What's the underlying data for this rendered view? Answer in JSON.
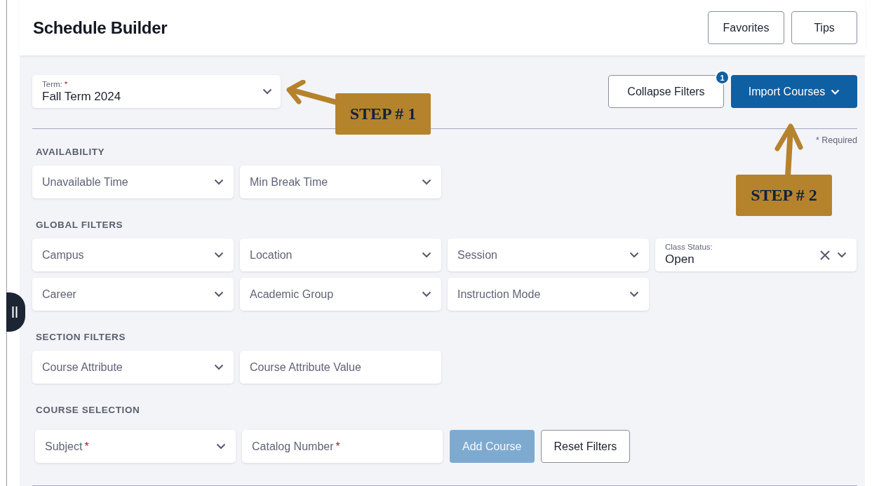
{
  "header": {
    "title": "Schedule Builder",
    "buttons": [
      {
        "label": "Favorites"
      },
      {
        "label": "Tips"
      }
    ]
  },
  "term": {
    "label": "Term:",
    "required_mark": "*",
    "value": "Fall Term 2024"
  },
  "actions": [
    {
      "label": "Collapse Filters",
      "kind": "outline",
      "badge": "1"
    },
    {
      "label": "Import Courses",
      "kind": "primary",
      "caret": true
    }
  ],
  "required_note": "* Required",
  "sections": [
    {
      "title": "AVAILABILITY",
      "rows": [
        [
          {
            "kind": "select",
            "placeholder": "Unavailable Time"
          },
          {
            "kind": "select",
            "placeholder": "Min Break Time"
          }
        ]
      ]
    },
    {
      "title": "GLOBAL FILTERS",
      "rows": [
        [
          {
            "kind": "select",
            "placeholder": "Campus"
          },
          {
            "kind": "select",
            "placeholder": "Location"
          },
          {
            "kind": "select",
            "placeholder": "Session"
          },
          {
            "kind": "select_value",
            "label": "Class Status:",
            "value": "Open",
            "clearable": true
          }
        ],
        [
          {
            "kind": "select",
            "placeholder": "Career"
          },
          {
            "kind": "select",
            "placeholder": "Academic Group"
          },
          {
            "kind": "select",
            "placeholder": "Instruction Mode"
          }
        ]
      ]
    },
    {
      "title": "SECTION FILTERS",
      "rows": [
        [
          {
            "kind": "select",
            "placeholder": "Course Attribute"
          },
          {
            "kind": "input",
            "placeholder": "Course Attribute Value"
          }
        ]
      ]
    },
    {
      "title": "COURSE SELECTION",
      "rows": [
        [
          {
            "kind": "select",
            "placeholder": "Subject",
            "required_mark": "*"
          },
          {
            "kind": "input",
            "placeholder": "Catalog Number",
            "required_mark": "*"
          },
          {
            "kind": "button",
            "label": "Add Course",
            "disabled": true
          },
          {
            "kind": "button",
            "label": "Reset Filters",
            "disabled": false
          }
        ]
      ]
    }
  ],
  "annotations": [
    {
      "kind": "arrow_left",
      "text": "STEP # 1"
    },
    {
      "kind": "arrow_up",
      "text": "STEP # 2"
    }
  ]
}
